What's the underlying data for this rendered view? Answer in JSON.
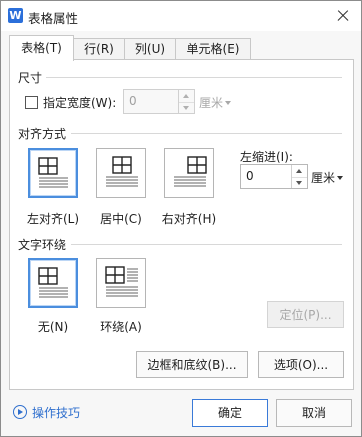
{
  "window": {
    "title": "表格属性",
    "app_icon_letter": "W"
  },
  "tabs": [
    "表格(T)",
    "行(R)",
    "列(U)",
    "单元格(E)"
  ],
  "size": {
    "section_label": "尺寸",
    "checkbox_label": "指定宽度(W):",
    "width_value": "0",
    "width_unit": "厘米"
  },
  "alignment": {
    "section_label": "对齐方式",
    "options": [
      "左对齐(L)",
      "居中(C)",
      "右对齐(H)"
    ],
    "selected": "左对齐(L)",
    "indent_label": "左缩进(I):",
    "indent_value": "0",
    "indent_unit": "厘米"
  },
  "wrapping": {
    "section_label": "文字环绕",
    "options": [
      "无(N)",
      "环绕(A)"
    ],
    "selected": "无(N)",
    "position_button": "定位(P)..."
  },
  "buttons": {
    "borders": "边框和底纹(B)...",
    "options": "选项(O)...",
    "ok": "确定",
    "cancel": "取消"
  },
  "help_link": "操作技巧",
  "colors": {
    "accent": "#4b8ede",
    "link": "#2f6fce"
  }
}
